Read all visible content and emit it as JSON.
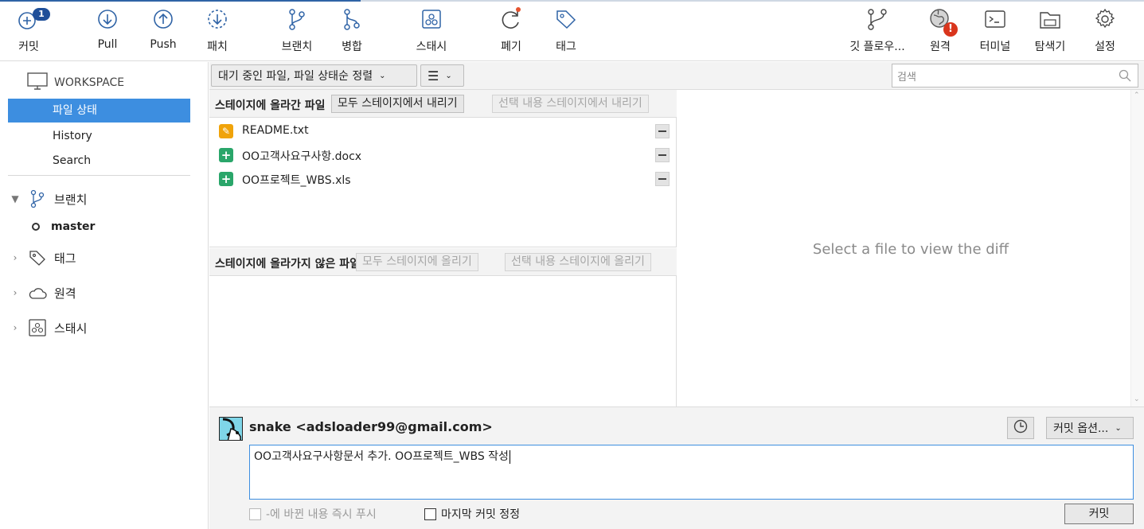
{
  "toolbar": {
    "commit": {
      "label": "커밋",
      "badge": "1",
      "icon": "commit-plus-icon"
    },
    "pull": {
      "label": "Pull",
      "icon": "pull-arrow-down-icon"
    },
    "push": {
      "label": "Push",
      "icon": "push-arrow-up-icon"
    },
    "fetch": {
      "label": "패치",
      "icon": "fetch-dashed-circle-icon"
    },
    "branch": {
      "label": "브랜치",
      "icon": "branch-icon"
    },
    "merge": {
      "label": "병합",
      "icon": "merge-icon"
    },
    "stash": {
      "label": "스태시",
      "icon": "stash-icon"
    },
    "discard": {
      "label": "폐기",
      "icon": "discard-icon"
    },
    "tag": {
      "label": "태그",
      "icon": "tag-icon"
    },
    "gitflow": {
      "label": "깃 플로우...",
      "icon": "git-flow-icon"
    },
    "remote": {
      "label": "원격",
      "icon": "globe-warning-icon"
    },
    "terminal": {
      "label": "터미널",
      "icon": "terminal-icon"
    },
    "explorer": {
      "label": "탐색기",
      "icon": "folder-icon"
    },
    "settings": {
      "label": "설정",
      "icon": "gear-icon"
    }
  },
  "sidebar": {
    "workspace_label": "WORKSPACE",
    "items": [
      {
        "label": "파일 상태",
        "active": true
      },
      {
        "label": "History",
        "active": false
      },
      {
        "label": "Search",
        "active": false
      }
    ],
    "groups": {
      "branches": "브랜치",
      "tags": "태그",
      "remotes": "원격",
      "stashes": "스태시"
    },
    "current_branch": "master"
  },
  "filter": {
    "sort_select": "대기 중인 파일, 파일 상태순 정렬",
    "view_select_icon": "list-icon",
    "search_placeholder": "검색"
  },
  "staged": {
    "title": "스테이지에 올라간 파일",
    "unstage_all": "모두 스테이지에서 내리기",
    "unstage_selected": "선택 내용 스테이지에서 내리기",
    "files": [
      {
        "name": "README.txt",
        "status": "modified",
        "status_glyph": "✎"
      },
      {
        "name": "OO고객사요구사항.docx",
        "status": "added",
        "status_glyph": "+"
      },
      {
        "name": "OO프로젝트_WBS.xls",
        "status": "added",
        "status_glyph": "+"
      }
    ]
  },
  "unstaged": {
    "title": "스테이지에 올라가지 않은 파일",
    "stage_all": "모두 스테이지에 올리기",
    "stage_selected": "선택 내용 스테이지에 올리기"
  },
  "diff": {
    "placeholder": "Select a file to view the diff"
  },
  "commit": {
    "author": "snake <adsloader99@gmail.com>",
    "message": "OO고객사요구사항문서 추가. OO프로젝트_WBS 작성",
    "options_label": "커밋 옵션...",
    "push_immediately": "-에 바뀐 내용 즉시 푸시",
    "amend_last": "마지막 커밋 정정",
    "commit_button": "커밋"
  },
  "colors": {
    "accent": "#3d8ee0",
    "badge": "#1f4f99",
    "modified": "#f0a30a",
    "added": "#2aa66a",
    "warning": "#d9351c"
  }
}
